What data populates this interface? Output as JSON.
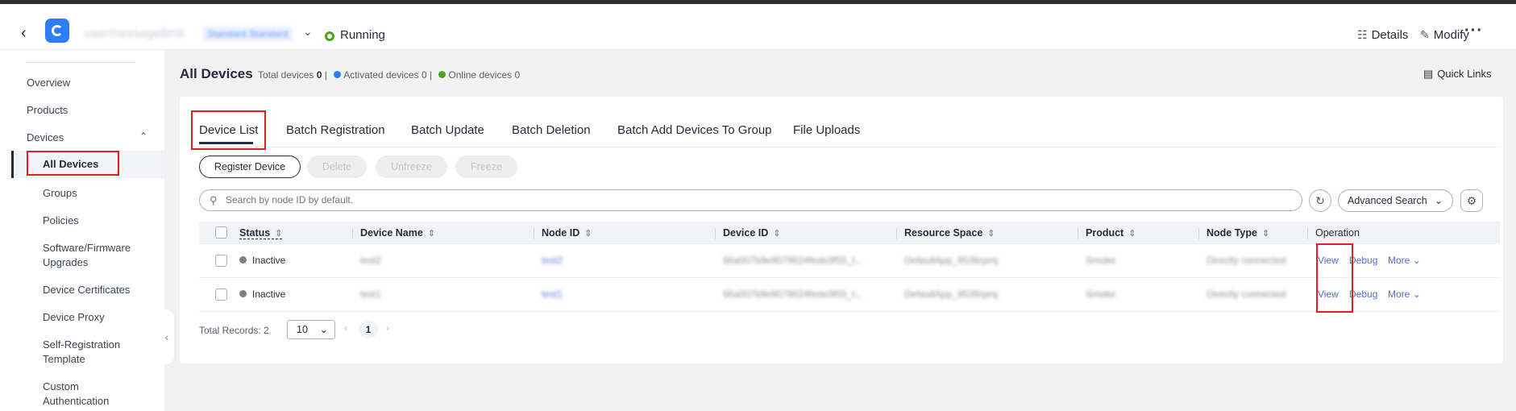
{
  "header": {
    "instance_name": "usermessagelimit",
    "edition_badge": "Standard  Standard",
    "status": "Running",
    "details_label": "Details",
    "modify_label": "Modify",
    "more_label": "···",
    "status_color": "#4ba524"
  },
  "sidebar": {
    "items": [
      {
        "label": "Overview"
      },
      {
        "label": "Products"
      },
      {
        "label": "Devices"
      },
      {
        "label": "All Devices"
      },
      {
        "label": "Groups"
      },
      {
        "label": "Policies"
      },
      {
        "label": "Software/Firmware Upgrades"
      },
      {
        "label": "Device Certificates"
      },
      {
        "label": "Device Proxy"
      },
      {
        "label": "Self-Registration Template"
      },
      {
        "label": "Custom Authentication"
      }
    ],
    "active_item": "All Devices"
  },
  "page": {
    "title": "All Devices",
    "total_label": "Total devices",
    "total_value": "0",
    "activated_label": "Activated devices",
    "activated_value": "0",
    "online_label": "Online devices",
    "online_value": "0",
    "quick_links_label": "Quick Links",
    "activated_color": "#2f7df6",
    "online_color": "#4ba524"
  },
  "tabs": [
    {
      "label": "Device List",
      "active": true
    },
    {
      "label": "Batch Registration"
    },
    {
      "label": "Batch Update"
    },
    {
      "label": "Batch Deletion"
    },
    {
      "label": "Batch Add Devices To Group"
    },
    {
      "label": "File Uploads"
    }
  ],
  "toolbar": {
    "register": "Register Device",
    "delete": "Delete",
    "unfreeze": "Unfreeze",
    "freeze": "Freeze"
  },
  "search": {
    "placeholder": "Search by node ID by default.",
    "advanced_label": "Advanced Search"
  },
  "table": {
    "columns": [
      "Status",
      "Device Name",
      "Node ID",
      "Device ID",
      "Resource Space",
      "Product",
      "Node Type",
      "Operation"
    ],
    "rows": [
      {
        "status": "Inactive",
        "device_name": "test2",
        "node_id": "test2",
        "device_id": "66a007b9e9079624fede3f55_t...",
        "resource_space": "DefaultApp_9536rpmj",
        "product": "Smoke",
        "node_type": "Directly connected"
      },
      {
        "status": "Inactive",
        "device_name": "test1",
        "node_id": "test1",
        "device_id": "66a007b9e9079624fede3f55_t...",
        "resource_space": "DefaultApp_9536rpmj",
        "product": "Smoke",
        "node_type": "Directly connected"
      }
    ],
    "actions": {
      "view": "View",
      "debug": "Debug",
      "more": "More"
    }
  },
  "pagination": {
    "total_label": "Total Records: 2",
    "page_size": "10",
    "current_page": "1"
  }
}
